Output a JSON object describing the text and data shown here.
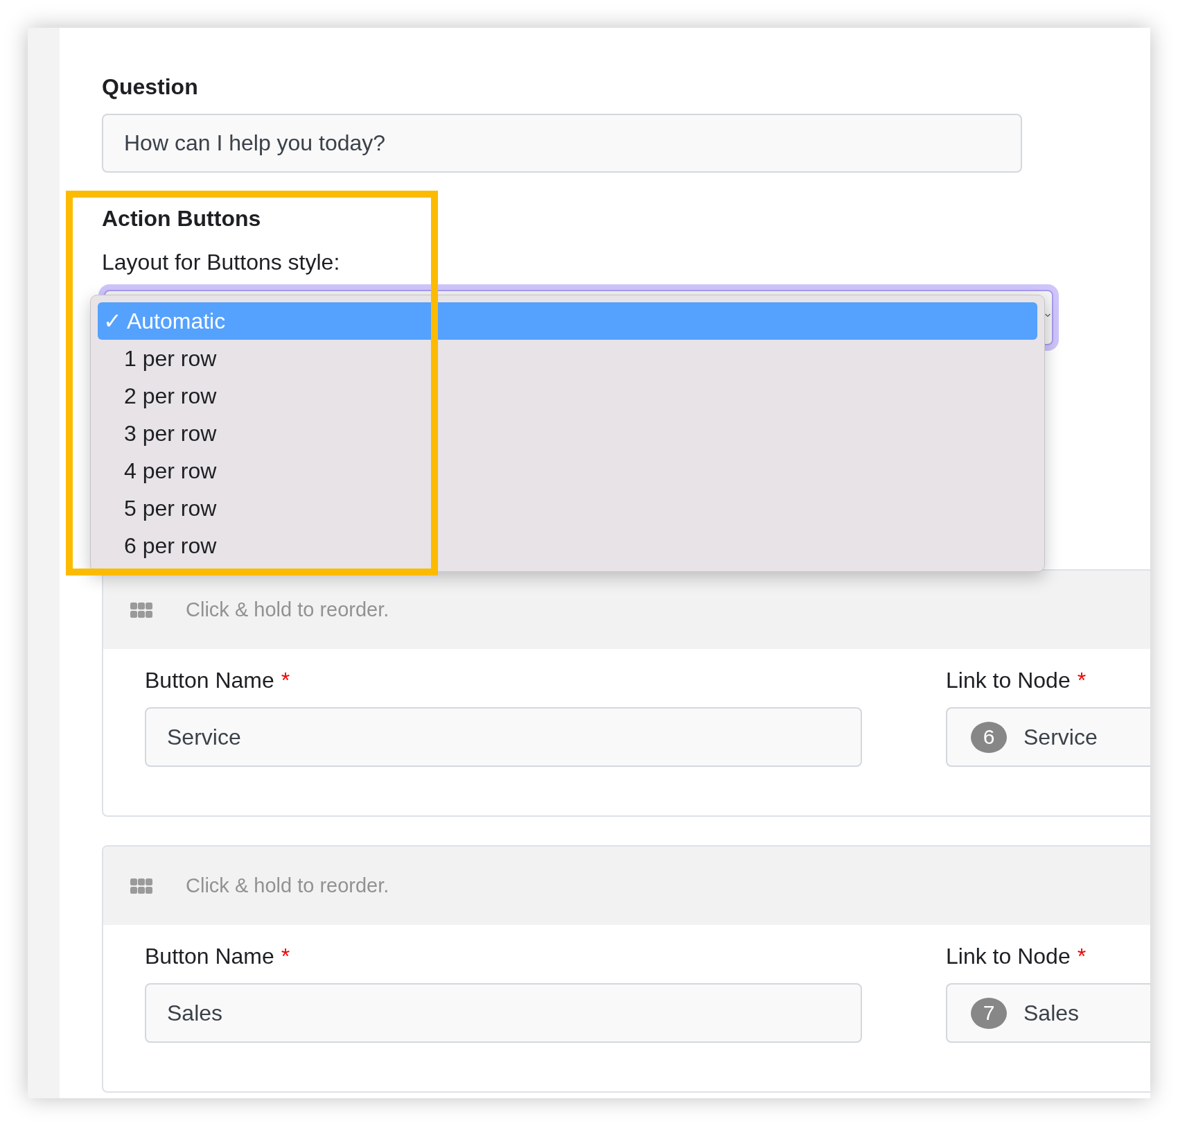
{
  "question": {
    "label": "Question",
    "value": "How can I help you today?"
  },
  "action_buttons": {
    "title": "Action Buttons",
    "layout_label": "Layout for Buttons style:",
    "layout_select": {
      "expanded": true,
      "check_mark": "✓",
      "options": [
        {
          "label": "Automatic",
          "selected": true
        },
        {
          "label": "1 per row",
          "selected": false
        },
        {
          "label": "2 per row",
          "selected": false
        },
        {
          "label": "3 per row",
          "selected": false
        },
        {
          "label": "4 per row",
          "selected": false
        },
        {
          "label": "5 per row",
          "selected": false
        },
        {
          "label": "6 per row",
          "selected": false
        }
      ]
    }
  },
  "buttons": [
    {
      "reorder_hint": "Click & hold to reorder.",
      "name_label": "Button Name",
      "name_required": "*",
      "name_value": "Service",
      "node_label": "Link to Node",
      "node_required": "*",
      "node_number": "6",
      "node_name": "Service"
    },
    {
      "reorder_hint": "Click & hold to reorder.",
      "name_label": "Button Name",
      "name_required": "*",
      "name_value": "Sales",
      "node_label": "Link to Node",
      "node_required": "*",
      "node_number": "7",
      "node_name": "Sales"
    }
  ]
}
